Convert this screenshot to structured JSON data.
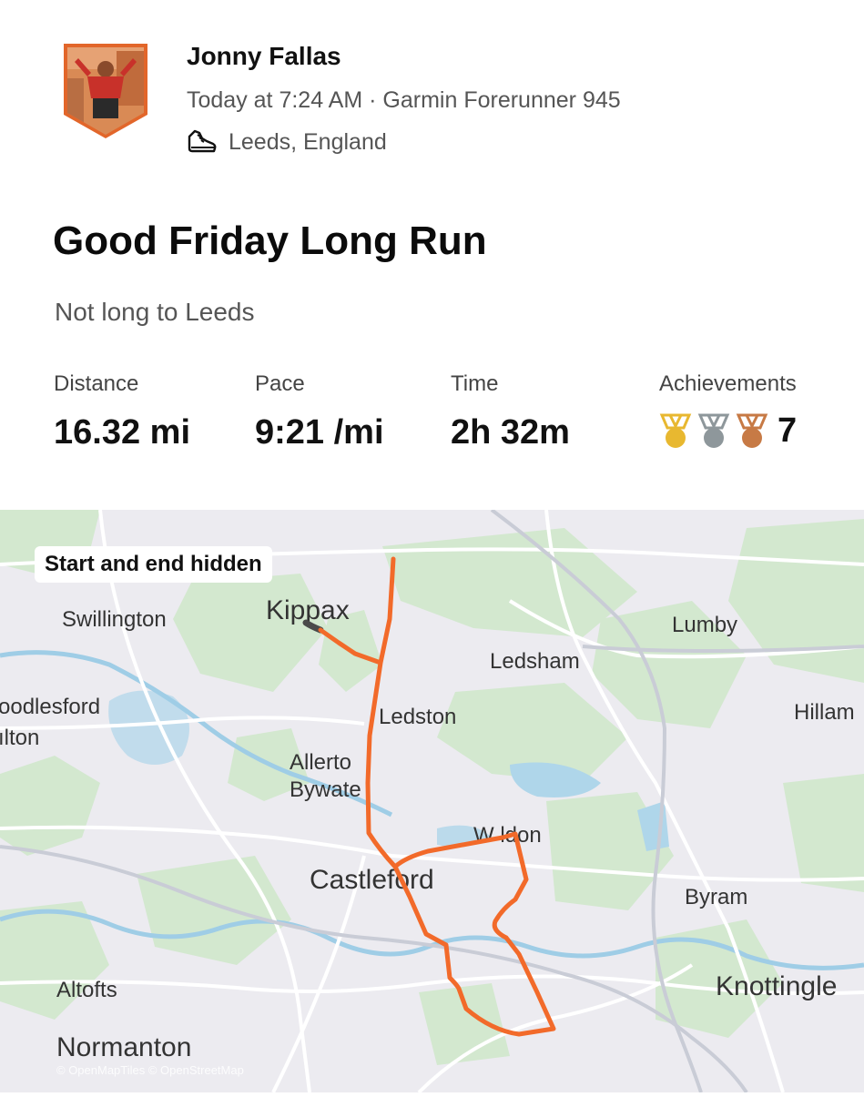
{
  "athlete": {
    "name": "Jonny Fallas",
    "timestamp": "Today at 7:24 AM",
    "separator": "·",
    "device": "Garmin Forerunner 945",
    "location": "Leeds, England",
    "avatar_icon": "avatar-badge",
    "activity_icon": "running-shoe-icon"
  },
  "activity": {
    "title": "Good Friday Long Run",
    "description": "Not long to Leeds"
  },
  "stats": {
    "distance": {
      "label": "Distance",
      "value": "16.32 mi"
    },
    "pace": {
      "label": "Pace",
      "value": "9:21 /mi"
    },
    "time": {
      "label": "Time",
      "value": "2h 32m"
    },
    "achievements": {
      "label": "Achievements",
      "count": "7",
      "medals": [
        {
          "name": "gold-medal-icon",
          "color": "#E8B830"
        },
        {
          "name": "silver-medal-icon",
          "color": "#8E979B"
        },
        {
          "name": "bronze-medal-icon",
          "color": "#C77A45"
        }
      ]
    }
  },
  "map": {
    "privacy_chip": "Start and end hidden",
    "route_color": "#F26A2A",
    "hidden_segment_color": "#4A4A4A",
    "places": [
      {
        "key": "kippax",
        "text": "Kippax"
      },
      {
        "key": "swillington",
        "text": "Swillington"
      },
      {
        "key": "lumby",
        "text": "Lumby"
      },
      {
        "key": "ledsham",
        "text": "Ledsham"
      },
      {
        "key": "woodlesford",
        "text": "oodlesford"
      },
      {
        "key": "oulton",
        "text": "ılton"
      },
      {
        "key": "ledston",
        "text": "Ledston"
      },
      {
        "key": "hillam",
        "text": "Hillam"
      },
      {
        "key": "allerton1",
        "text": "Allerto"
      },
      {
        "key": "allerton2",
        "text": "Bywate"
      },
      {
        "key": "wheldon",
        "text": "W   ldon"
      },
      {
        "key": "castleford",
        "text": "Castleford"
      },
      {
        "key": "byram",
        "text": "Byram"
      },
      {
        "key": "altofts",
        "text": "Altofts"
      },
      {
        "key": "knottingley",
        "text": "Knottingle"
      },
      {
        "key": "normanton",
        "text": "Normanton"
      }
    ],
    "attribution": "© OpenMapTiles © OpenStreetMap"
  }
}
